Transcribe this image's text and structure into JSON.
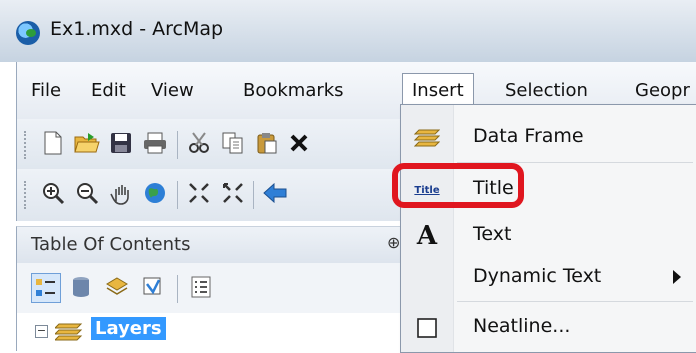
{
  "window": {
    "title": "Ex1.mxd - ArcMap"
  },
  "menubar": {
    "items": [
      {
        "label": "File"
      },
      {
        "label": "Edit"
      },
      {
        "label": "View"
      },
      {
        "label": "Bookmarks"
      },
      {
        "label": "Insert",
        "open": true
      },
      {
        "label": "Selection"
      },
      {
        "label": "Geopr"
      }
    ]
  },
  "toc": {
    "title": "Table Of Contents",
    "pin_glyph": "⊕",
    "root_label": "Layers",
    "expander_glyph": "−"
  },
  "insert_menu": {
    "items": [
      {
        "label": "Data Frame",
        "icon": "data-frame-icon"
      },
      {
        "label": "Title",
        "icon": "title-icon",
        "icon_text": "Title",
        "highlighted": true
      },
      {
        "label": "Text",
        "icon": "text-icon",
        "icon_text": "A"
      },
      {
        "label": "Dynamic Text",
        "icon": "none",
        "submenu": true
      },
      {
        "label": "Neatline...",
        "icon": "neatline-icon"
      }
    ]
  },
  "colors": {
    "highlight_ring": "#e0161f",
    "selection": "#3399ff"
  }
}
